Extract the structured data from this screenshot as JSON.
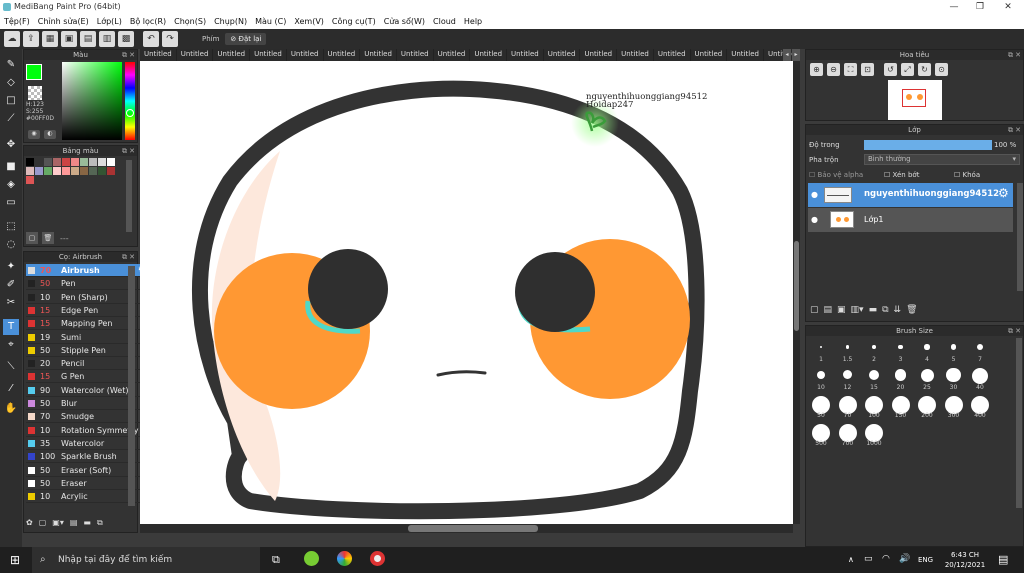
{
  "window": {
    "title": "MediBang Paint Pro (64bit)",
    "min": "—",
    "max": "❐",
    "close": "✕"
  },
  "menu": [
    "Tệp(F)",
    "Chỉnh sửa(E)",
    "Lớp(L)",
    "Bộ lọc(R)",
    "Chọn(S)",
    "Chụp(N)",
    "Màu (C)",
    "Xem(V)",
    "Công cụ(T)",
    "Cửa sổ(W)",
    "Cloud",
    "Help"
  ],
  "toolbar": {
    "phim_label": "Phím",
    "reset_label": "Đặt lại"
  },
  "color_panel": {
    "title": "Màu",
    "h": "H:123",
    "s": "S:255",
    "hex": "#00FF0D",
    "primary_color": "#00ff0d"
  },
  "palette_panel": {
    "title": "Bảng màu",
    "dash": "---",
    "swatches": [
      "#000000",
      "#333333",
      "#555555",
      "#aa6666",
      "#cc4444",
      "#ee8888",
      "#99bb99",
      "#bbbbbb",
      "#dddddd",
      "#ffffff",
      "#ddbbbb",
      "#9999cc",
      "#66aa66",
      "#ffcccc",
      "#ff9999",
      "#ccaa88",
      "#886644",
      "#556655",
      "#335533",
      "#aa3333",
      "#dd5555"
    ]
  },
  "brush_panel": {
    "title": "Cọ: Airbrush",
    "brushes": [
      {
        "size": "70",
        "name": "Airbrush",
        "color": "#dddddd"
      },
      {
        "size": "50",
        "name": "Pen",
        "color": "#222222"
      },
      {
        "size": "10",
        "name": "Pen (Sharp)",
        "color": "#222222"
      },
      {
        "size": "15",
        "name": "Edge Pen",
        "color": "#dd3333"
      },
      {
        "size": "15",
        "name": "Mapping Pen",
        "color": "#dd3333"
      },
      {
        "size": "19",
        "name": "Sumi",
        "color": "#eecc00"
      },
      {
        "size": "50",
        "name": "Stipple Pen",
        "color": "#eecc00"
      },
      {
        "size": "20",
        "name": "Pencil",
        "color": "#222222"
      },
      {
        "size": "15",
        "name": "G Pen",
        "color": "#dd3333"
      },
      {
        "size": "90",
        "name": "Watercolor (Wet)",
        "color": "#55ccee"
      },
      {
        "size": "50",
        "name": "Blur",
        "color": "#cc88dd"
      },
      {
        "size": "70",
        "name": "Smudge",
        "color": "#f4d8c8"
      },
      {
        "size": "10",
        "name": "Rotation Symmetry",
        "color": "#dd3333"
      },
      {
        "size": "35",
        "name": "Watercolor",
        "color": "#55ccee"
      },
      {
        "size": "100",
        "name": "Sparkle Brush",
        "color": "#3344cc"
      },
      {
        "size": "50",
        "name": "Eraser (Soft)",
        "color": "#ffffff"
      },
      {
        "size": "50",
        "name": "Eraser",
        "color": "#ffffff"
      },
      {
        "size": "10",
        "name": "Acrylic",
        "color": "#eecc00"
      }
    ]
  },
  "tabs": [
    "Untitled",
    "Untitled",
    "Untitled",
    "Untitled",
    "Untitled",
    "Untitled",
    "Untitled",
    "Untitled",
    "Untitled",
    "Untitled",
    "Untitled",
    "Untitled",
    "Untitled",
    "Untitled",
    "Untitled",
    "Untitled",
    "Untitled",
    "Untitled",
    "Untitled",
    "Untitled",
    "Untitled",
    "Untitled",
    "Untitled",
    "Untitled",
    "Untitled",
    "Untitled",
    "Untitled",
    "Untitled",
    "Untitled",
    "Untitled",
    "Untitled",
    "Untitled",
    "Untitled",
    "Untitled",
    "Untitled",
    "Untitled",
    "Untitled",
    "Untitled",
    "Untitled"
  ],
  "canvas_text": {
    "line1": "nguyenthihuonggiang94512",
    "line2": "Hoidap247"
  },
  "navigator": {
    "title": "Hoa tiêu"
  },
  "layer_panel": {
    "title": "Lớp",
    "opacity_label": "Độ trong",
    "opacity_value": "100 %",
    "opacity": 1.0,
    "blend_label": "Pha trộn",
    "blend_value": "Bình thường",
    "protect_alpha": "Bảo vệ alpha",
    "clipping": "Xén bớt",
    "lock": "Khóa",
    "layers": [
      {
        "name": "nguyenthihuonggiang94512"
      },
      {
        "name": "Lớp1"
      }
    ]
  },
  "brush_size_panel": {
    "title": "Brush Size",
    "sizes": [
      "1",
      "1.5",
      "2",
      "3",
      "4",
      "5",
      "7",
      "10",
      "12",
      "15",
      "20",
      "25",
      "30",
      "40",
      "50",
      "70",
      "100",
      "150",
      "200",
      "300",
      "400",
      "500",
      "700",
      "1000"
    ]
  },
  "taskbar": {
    "search_placeholder": "Nhập tại đây để tìm kiếm",
    "lang": "ENG",
    "time": "6:43 CH",
    "date": "20/12/2021"
  }
}
